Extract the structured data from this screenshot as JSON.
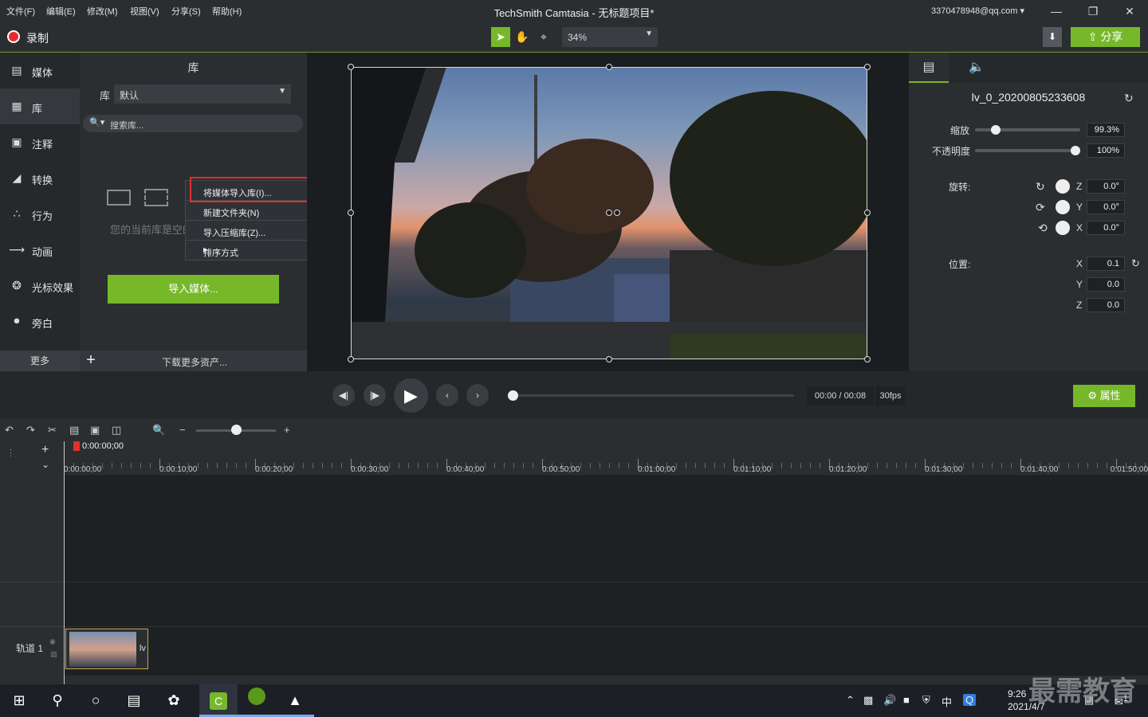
{
  "menubar": {
    "items": [
      "文件(F)",
      "编辑(E)",
      "修改(M)",
      "视图(V)",
      "分享(S)",
      "帮助(H)"
    ],
    "window_title": "TechSmith Camtasia - 无标题项目*",
    "account": "3370478948@qq.com ▾"
  },
  "toolbar": {
    "record_label": "录制",
    "zoom_value": "34%",
    "share_label": "分享"
  },
  "leftnav": {
    "items": [
      {
        "label": "媒体",
        "icon": "media-icon"
      },
      {
        "label": "库",
        "icon": "library-icon"
      },
      {
        "label": "注释",
        "icon": "annotation-icon"
      },
      {
        "label": "转换",
        "icon": "transition-icon"
      },
      {
        "label": "行为",
        "icon": "behavior-icon"
      },
      {
        "label": "动画",
        "icon": "animation-icon"
      },
      {
        "label": "光标效果",
        "icon": "cursor-effect-icon"
      },
      {
        "label": "旁白",
        "icon": "microphone-icon"
      }
    ],
    "more_label": "更多"
  },
  "library": {
    "title": "库",
    "lib_label": "库",
    "lib_selected": "默认",
    "search_placeholder": "搜索库...",
    "empty_text": "您的当前库是空的，将媒体导入您的库中，以",
    "import_button": "导入媒体...",
    "download_more": "下载更多资产..."
  },
  "context_menu": {
    "items": [
      "将媒体导入库(I)...",
      "新建文件夹(N)",
      "导入压缩库(Z)...",
      "排序方式"
    ]
  },
  "properties": {
    "clip_name": "lv_0_20200805233608",
    "scale_label": "缩放",
    "scale_value": "99.3%",
    "scale_fraction": 0.2,
    "opacity_label": "不透明度",
    "opacity_value": "100%",
    "opacity_fraction": 1.0,
    "rotation_label": "旋转:",
    "rotation": [
      {
        "axis": "Z",
        "value": "0.0°"
      },
      {
        "axis": "Y",
        "value": "0.0°"
      },
      {
        "axis": "X",
        "value": "0.0°"
      }
    ],
    "position_label": "位置:",
    "position": [
      {
        "axis": "X",
        "value": "0.1"
      },
      {
        "axis": "Y",
        "value": "0.0"
      },
      {
        "axis": "Z",
        "value": "0.0"
      }
    ]
  },
  "playback": {
    "time": "00:00 / 00:08",
    "fps": "30fps",
    "properties_button": "属性"
  },
  "timeline": {
    "playhead_time": "0:00:00;00",
    "ticks": [
      "0:00:00;00",
      "0:00:10;00",
      "0:00:20;00",
      "0:00:30;00",
      "0:00:40;00",
      "0:00:50;00",
      "0:01:00;00",
      "0:01:10;00",
      "0:01:20;00",
      "0:01:30;00",
      "0:01:40;00",
      "0:01:50;00"
    ],
    "track_label": "轨道 1",
    "clip_label": "lv"
  },
  "taskbar": {
    "ime": "中",
    "clock_time": "9:26",
    "clock_date": "2021/4/7",
    "notif_count": "1"
  },
  "watermark": "最需教育",
  "colors": {
    "accent": "#77b82a",
    "record": "#e9292d",
    "highlight": "#e0302f"
  }
}
